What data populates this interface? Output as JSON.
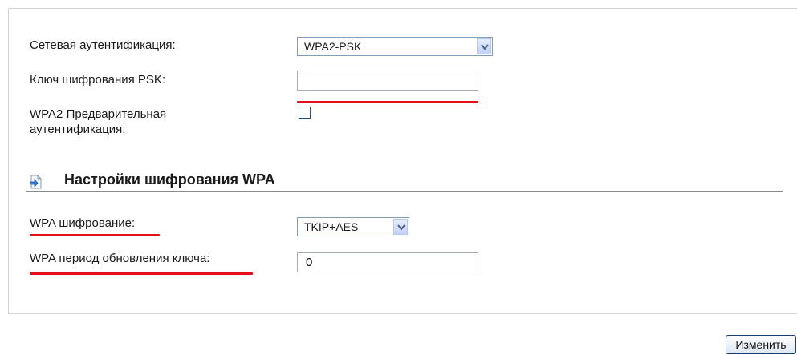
{
  "form": {
    "auth_label": "Сетевая аутентификация:",
    "auth_value": "WPA2-PSK",
    "psk_label": "Ключ шифрования PSK:",
    "psk_value": "",
    "preauth_label_line1": "WPA2 Предварительная",
    "preauth_label_line2": "аутентификация:",
    "preauth_checked": false
  },
  "wpa_section": {
    "title": "Настройки шифрования WPA",
    "icon": "arrow-page-icon",
    "encryption_label": "WPA шифрование:",
    "encryption_value": "TKIP+AES",
    "rekey_label": "WPA период обновления ключа:",
    "rekey_value": "0"
  },
  "actions": {
    "apply_label": "Изменить"
  },
  "colors": {
    "highlight": "#e3101b",
    "field_border": "#7f9db9",
    "checkbox_border": "#1c5180",
    "section_rule": "#8a8a8a"
  },
  "icons": {
    "dropdown": "chevron-down-icon",
    "section": "arrow-page-icon"
  }
}
